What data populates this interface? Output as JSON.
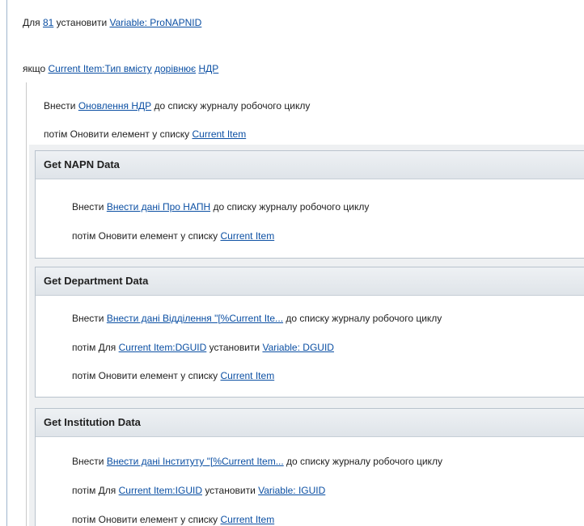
{
  "top": {
    "line1": {
      "pre": "Для ",
      "num": "81",
      "mid": " установити ",
      "var": "Variable: ProNAPNID"
    },
    "cond": {
      "pre": "якщо ",
      "field": "Current Item:Тип вмісту",
      "op": "дорівнює",
      "val": "НДР"
    },
    "log": {
      "pre": "Внести ",
      "msg": "Оновлення НДР",
      "post": " до списку журналу робочого циклу"
    },
    "update": {
      "pre": "потім Оновити елемент у списку ",
      "item": "Current Item"
    }
  },
  "steps": [
    {
      "title": "Get NAPN Data",
      "lines": [
        {
          "pre": "Внести ",
          "link": "Внести дані Про НАПН",
          "post": " до списку журналу робочого циклу"
        },
        {
          "pre": "потім Оновити елемент у списку ",
          "link": "Current Item"
        }
      ]
    },
    {
      "title": "Get Department Data",
      "lines": [
        {
          "pre": "Внести ",
          "link": "Внести дані Відділення \"[%Current Ite...",
          "post": " до списку журналу робочого циклу"
        },
        {
          "pre": "потім Для ",
          "link": "Current Item:DGUID",
          "mid": " установити ",
          "link2": "Variable: DGUID"
        },
        {
          "pre": "потім Оновити елемент у списку ",
          "link": "Current Item"
        }
      ]
    },
    {
      "title": "Get Institution Data",
      "lines": [
        {
          "pre": "Внести ",
          "link": "Внести дані Інституту \"[%Current Item...",
          "post": " до списку журналу робочого циклу"
        },
        {
          "pre": "потім Для ",
          "link": "Current Item:IGUID",
          "mid": " установити ",
          "link2": "Variable: IGUID"
        },
        {
          "pre": "потім Оновити елемент у списку ",
          "link": "Current Item"
        }
      ]
    }
  ]
}
